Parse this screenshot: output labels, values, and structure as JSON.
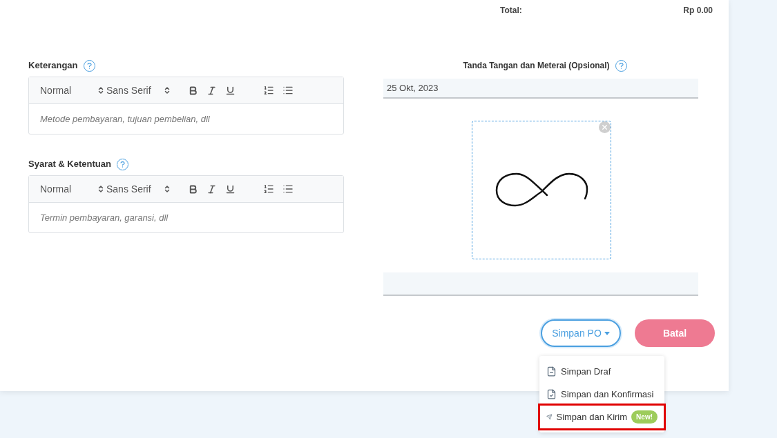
{
  "total": {
    "label": "Total:",
    "value": "Rp 0.00"
  },
  "editors": [
    {
      "label": "Keterangan",
      "format": "Normal",
      "font": "Sans Serif",
      "placeholder": "Metode pembayaran, tujuan pembelian, dll"
    },
    {
      "label": "Syarat & Ketentuan",
      "format": "Normal",
      "font": "Sans Serif",
      "placeholder": "Termin pembayaran, garansi, dll"
    }
  ],
  "signature": {
    "title": "Tanda Tangan dan Meterai (Opsional)",
    "date": "25 Okt, 2023"
  },
  "save_button": {
    "label": "Simpan PO",
    "expanded": true
  },
  "cancel_button": {
    "label": "Batal"
  },
  "save_menu": [
    {
      "kind": "draft",
      "label": "Simpan Draf",
      "highlighted": false
    },
    {
      "kind": "confirm",
      "label": "Simpan dan Konfirmasi",
      "highlighted": false
    },
    {
      "kind": "send",
      "label": "Simpan dan Kirim",
      "badge": "New!",
      "highlighted": true
    }
  ]
}
